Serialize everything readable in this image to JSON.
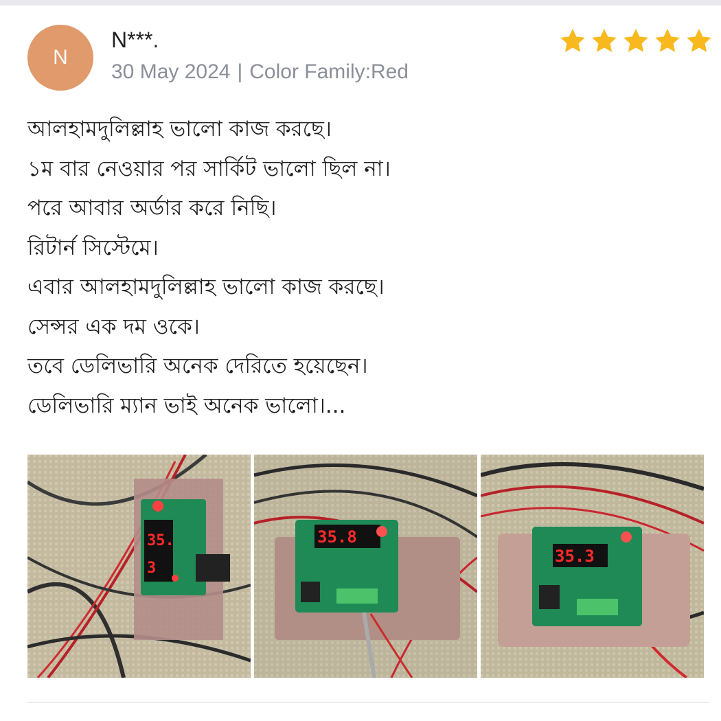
{
  "reviewer": {
    "initial": "N",
    "name": "N***.",
    "date": "30 May 2024",
    "separator": "|",
    "variant": "Color Family:Red"
  },
  "rating": {
    "value": 5,
    "max": 5,
    "star_color": "#f8b91e",
    "icon": "star-icon"
  },
  "review": {
    "lines": [
      "আলহামদুলিল্লাহ ভালো কাজ করছে।",
      "১ম বার নেওয়ার পর সার্কিট ভালো ছিল না।",
      "পরে আবার অর্ডার করে নিছি।",
      "রিটার্ন সিস্টেমে।",
      "এবার আলহামদুলিল্লাহ ভালো কাজ করছে।",
      "সেন্সর এক দম ওকে।",
      "তবে ডেলিভারি অনেক দেরিতে হয়েছেন।",
      "ডেলিভারি ম্যান ভাই অনেক ভালো।..."
    ]
  },
  "photos": [
    {
      "display": "35.",
      "display2": "3"
    },
    {
      "display": "35.8"
    },
    {
      "display": "35.3"
    }
  ],
  "colors": {
    "avatar": "#e09a6b",
    "meta_text": "#8a8f99",
    "led": "#ff2a2a",
    "pcb": "#1f8a55"
  }
}
